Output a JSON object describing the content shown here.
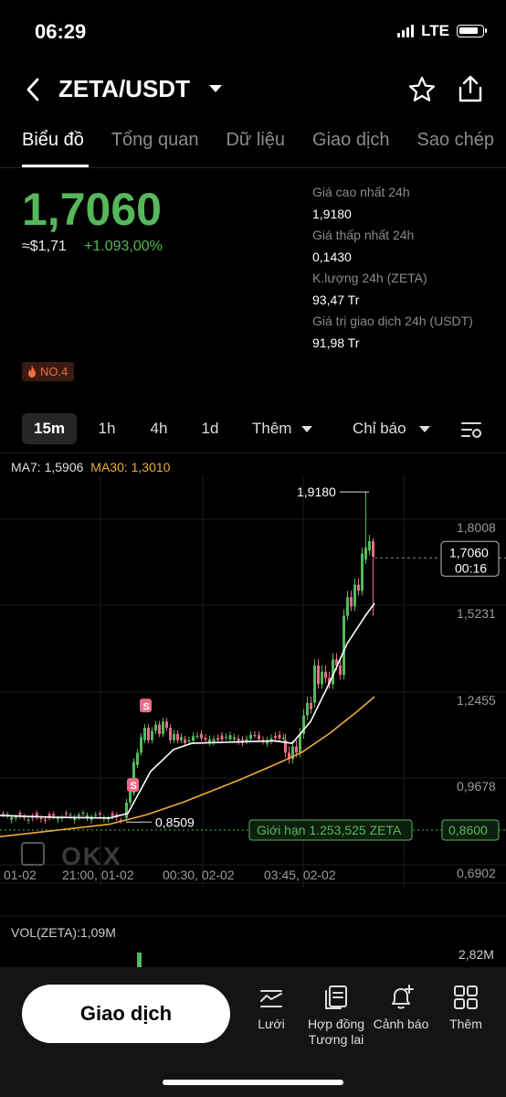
{
  "status": {
    "time": "06:29",
    "network": "LTE"
  },
  "header": {
    "pair": "ZETA/USDT"
  },
  "tabs": [
    "Biểu đồ",
    "Tổng quan",
    "Dữ liệu",
    "Giao dịch",
    "Sao chép"
  ],
  "summary": {
    "price": "1,7060",
    "approx": "≈$1,71",
    "change": "+1.093,00%",
    "badge": "NO.4",
    "stats": [
      {
        "label": "Giá cao nhất 24h",
        "value": "1,9180"
      },
      {
        "label": "Giá thấp nhất 24h",
        "value": "0,1430"
      },
      {
        "label": "K.lượng 24h (ZETA)",
        "value": "93,47 Tr"
      },
      {
        "label": "Giá trị giao dịch 24h (USDT)",
        "value": "91,98 Tr"
      }
    ]
  },
  "timeframes": [
    "15m",
    "1h",
    "4h",
    "1d",
    "Thêm",
    "Chỉ báo"
  ],
  "chart": {
    "ma7_label": "MA7: 1,5906",
    "ma30_label": "MA30: 1,3010",
    "y_ticks": [
      "1,8008",
      "1,5231",
      "1,2455",
      "0,9678",
      "0,6902"
    ],
    "x_ticks": [
      "01-02",
      "21:00, 01-02",
      "00:30, 02-02",
      "03:45, 02-02"
    ],
    "high_label": "1,9180",
    "low_label": "0,8509",
    "current_price": "1,7060",
    "countdown": "00:16",
    "limit_order": "Giới hạn 1.253,525 ZETA",
    "limit_price": "0,8600",
    "watermark": "OKX",
    "colors": {
      "up": "#55b85a",
      "down": "#e86c87",
      "ma7": "#ffffff",
      "ma30": "#f0a93a"
    }
  },
  "volume": {
    "label": "VOL(ZETA):1,09M",
    "max": "2,82M"
  },
  "bottom": {
    "trade_button": "Giao dịch",
    "nav": [
      {
        "label": "Lưới",
        "icon": "grid-trading-icon"
      },
      {
        "label": "Hợp đồng Tương lai",
        "icon": "futures-contract-icon"
      },
      {
        "label": "Cảnh báo",
        "icon": "alert-bell-icon"
      },
      {
        "label": "Thêm",
        "icon": "more-apps-icon"
      }
    ]
  }
}
